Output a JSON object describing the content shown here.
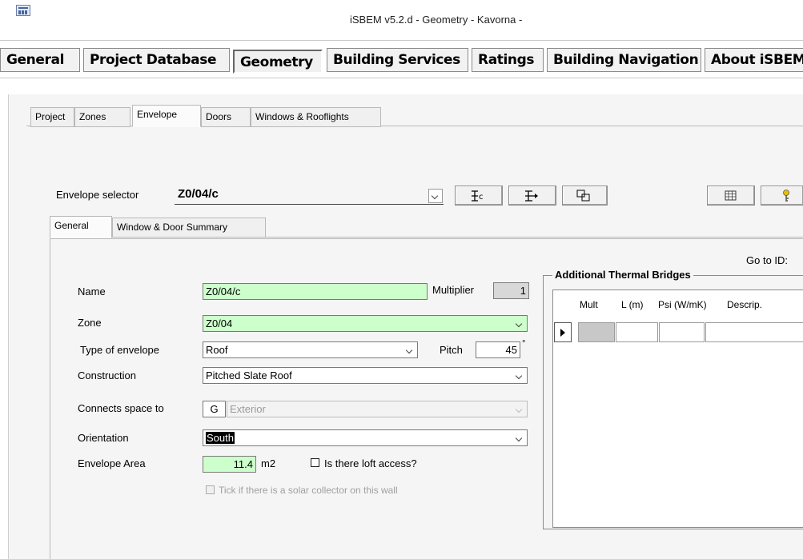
{
  "window": {
    "title": "iSBEM v5.2.d - Geometry - Kavorna -"
  },
  "menu": {
    "general": "General",
    "project_database": "Project Database",
    "geometry": "Geometry",
    "building_services": "Building Services",
    "ratings": "Ratings",
    "building_navigation": "Building Navigation",
    "about": "About iSBEM"
  },
  "tabs": {
    "project": "Project",
    "zones": "Zones",
    "envelope": "Envelope",
    "doors": "Doors",
    "windows": "Windows & Rooflights"
  },
  "selector": {
    "label": "Envelope selector",
    "value": "Z0/04/c"
  },
  "subtabs": {
    "general": "General",
    "summary": "Window & Door Summary"
  },
  "form": {
    "name_label": "Name",
    "name_value": "Z0/04/c",
    "multiplier_label": "Multiplier",
    "multiplier_value": "1",
    "zone_label": "Zone",
    "zone_value": "Z0/04",
    "type_label": "Type of envelope",
    "type_value": "Roof",
    "pitch_label": "Pitch",
    "pitch_value": "45",
    "pitch_unit": "°",
    "construction_label": "Construction",
    "construction_value": "Pitched Slate Roof",
    "connects_label": "Connects space to",
    "connects_code": "G",
    "connects_value": "Exterior",
    "orientation_label": "Orientation",
    "orientation_value": "South",
    "area_label": "Envelope Area",
    "area_value": "11.4",
    "area_unit": "m2",
    "loft_label": "Is there loft access?",
    "solar_label": "Tick if there is a solar collector on this wall"
  },
  "goto": {
    "label": "Go to ID:"
  },
  "thermal": {
    "title": "Additional Thermal Bridges",
    "columns": [
      "Mult",
      "L (m)",
      "Psi (W/mK)",
      "Descrip."
    ]
  },
  "icons": [
    "app-icon",
    "dropdown-arrow-icon",
    "add-record-icon",
    "next-record-icon",
    "copy-record-icon",
    "table-icon",
    "help-key-icon",
    "row-pointer-icon"
  ]
}
